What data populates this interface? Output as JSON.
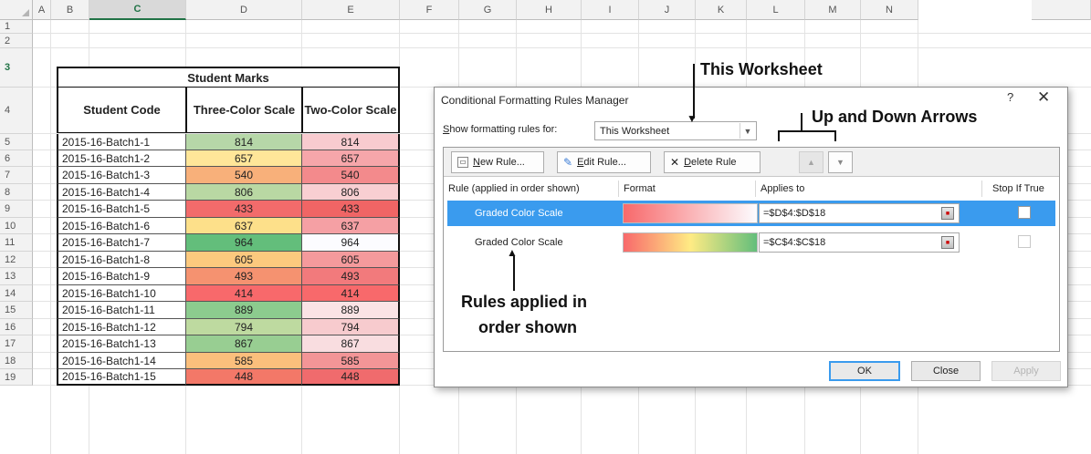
{
  "columns": [
    "A",
    "B",
    "C",
    "D",
    "E",
    "F",
    "G",
    "H",
    "I",
    "J",
    "K",
    "L",
    "M",
    "N"
  ],
  "rows": [
    "1",
    "2",
    "3",
    "4",
    "5",
    "6",
    "7",
    "8",
    "9",
    "10",
    "11",
    "12",
    "13",
    "14",
    "15",
    "16",
    "17",
    "18",
    "19"
  ],
  "table": {
    "title": "Student Marks",
    "headers": {
      "code": "Student Code",
      "three": "Three-Color Scale",
      "two": "Two-Color Scale"
    },
    "rows": [
      {
        "code": "2015-16-Batch1-1",
        "three": "814",
        "two": "814",
        "c3": "#b6d7a8",
        "c2": "#f8cbcf"
      },
      {
        "code": "2015-16-Batch1-2",
        "three": "657",
        "two": "657",
        "c3": "#ffe699",
        "c2": "#f6a6aa"
      },
      {
        "code": "2015-16-Batch1-3",
        "three": "540",
        "two": "540",
        "c3": "#f8b07a",
        "c2": "#f38a8c"
      },
      {
        "code": "2015-16-Batch1-4",
        "three": "806",
        "two": "806",
        "c3": "#b9d8a3",
        "c2": "#f8cfd2"
      },
      {
        "code": "2015-16-Batch1-5",
        "three": "433",
        "two": "433",
        "c3": "#f26b6b",
        "c2": "#f06565"
      },
      {
        "code": "2015-16-Batch1-6",
        "three": "637",
        "two": "637",
        "c3": "#fde08a",
        "c2": "#f5a0a4"
      },
      {
        "code": "2015-16-Batch1-7",
        "three": "964",
        "two": "964",
        "c3": "#63be7b",
        "c2": "#fcfcff"
      },
      {
        "code": "2015-16-Batch1-8",
        "three": "605",
        "two": "605",
        "c3": "#fcc97e",
        "c2": "#f49a9c"
      },
      {
        "code": "2015-16-Batch1-9",
        "three": "493",
        "two": "493",
        "c3": "#f59270",
        "c2": "#f27a7c"
      },
      {
        "code": "2015-16-Batch1-10",
        "three": "414",
        "two": "414",
        "c3": "#f8696b",
        "c2": "#f8696b"
      },
      {
        "code": "2015-16-Batch1-11",
        "three": "889",
        "two": "889",
        "c3": "#8ccb8e",
        "c2": "#fae3e5"
      },
      {
        "code": "2015-16-Batch1-12",
        "three": "794",
        "two": "794",
        "c3": "#bedaa0",
        "c2": "#f7cbce"
      },
      {
        "code": "2015-16-Batch1-13",
        "three": "867",
        "two": "867",
        "c3": "#98ce92",
        "c2": "#f9dde0"
      },
      {
        "code": "2015-16-Batch1-14",
        "three": "585",
        "two": "585",
        "c3": "#fbbf7c",
        "c2": "#f39597"
      },
      {
        "code": "2015-16-Batch1-15",
        "three": "448",
        "two": "448",
        "c3": "#f37868",
        "c2": "#f06b6d"
      }
    ]
  },
  "dialog": {
    "title": "Conditional Formatting Rules Manager",
    "help": "?",
    "close": "✕",
    "show_label_prefix": "S",
    "show_label_rest": "how formatting rules for:",
    "show_value": "This Worksheet",
    "toolbar": {
      "new_rule": {
        "u": "N",
        "rest": "ew Rule..."
      },
      "edit_rule": {
        "u": "E",
        "rest": "dit Rule..."
      },
      "delete_rule": {
        "u": "D",
        "rest": "elete Rule"
      }
    },
    "list_headers": {
      "rule": "Rule (applied in order shown)",
      "format": "Format",
      "applies": "Applies to",
      "stop": "Stop If True"
    },
    "rules": [
      {
        "name": "Graded Color Scale",
        "applies": "=$D$4:$D$18",
        "selected": true,
        "gradient": [
          "#f8696b",
          "#fcfcff"
        ]
      },
      {
        "name": "Graded Color Scale",
        "applies": "=$C$4:$C$18",
        "selected": false,
        "gradient": [
          "#f8696b",
          "#ffeb84",
          "#63be7b"
        ]
      }
    ],
    "buttons": {
      "ok": "OK",
      "close": "Close",
      "apply": "Apply"
    }
  },
  "annotations": {
    "this_worksheet": "This Worksheet",
    "arrows": "Up and Down Arrows",
    "rules_applied_l1": "Rules applied in",
    "rules_applied_l2": "order shown"
  },
  "colors": {
    "selection_blue": "#3a9bee",
    "excel_green": "#217346"
  }
}
